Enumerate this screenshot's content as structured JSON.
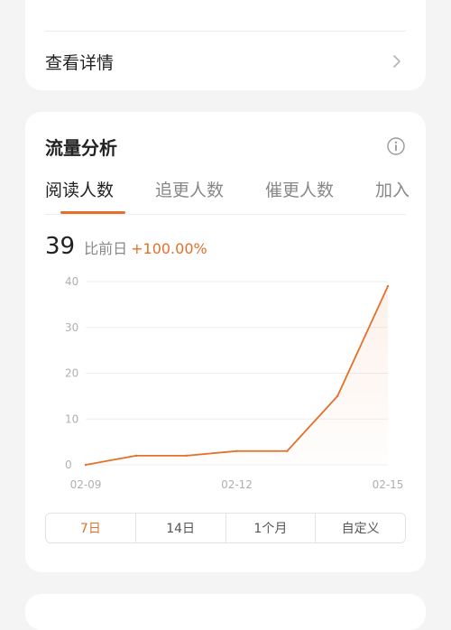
{
  "details": {
    "label": "查看详情"
  },
  "traffic": {
    "title": "流量分析",
    "tabs": [
      "阅读人数",
      "追更人数",
      "催更人数",
      "加入"
    ],
    "active_tab": 0,
    "metric_value": "39",
    "compare_label": "比前日",
    "change": "+100.00%"
  },
  "colors": {
    "accent": "#e4702a",
    "grid": "#eeeeee",
    "axis_text": "#b0b0b0"
  },
  "icons": {
    "details": "chevron-right-icon",
    "info": "info-icon"
  },
  "chart_data": {
    "type": "area",
    "x": [
      "02-09",
      "02-10",
      "02-11",
      "02-12",
      "02-13",
      "02-14",
      "02-15"
    ],
    "x_tick_labels": [
      "02-09",
      "02-12",
      "02-15"
    ],
    "values": [
      0,
      2,
      2,
      3,
      3,
      15,
      39
    ],
    "y_ticks": [
      0,
      10,
      20,
      30,
      40
    ],
    "ylim": [
      0,
      40
    ],
    "grid": true,
    "title": "",
    "xlabel": "",
    "ylabel": ""
  },
  "ranges": [
    "7日",
    "14日",
    "1个月",
    "自定义"
  ],
  "active_range": 0
}
